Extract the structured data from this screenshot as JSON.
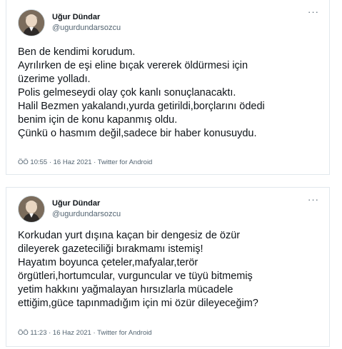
{
  "tweets": [
    {
      "author": {
        "display_name": "Uğur Dündar",
        "handle": "@ugurdundarsozcu",
        "avatar_icon": "profile-photo"
      },
      "more_icon": "···",
      "lines": [
        "Ben de kendimi korudum.",
        "Ayrılırken de eşi eline bıçak vererek öldürmesi için",
        "üzerime yolladı.",
        "Polis gelmeseydi olay çok kanlı sonuçlanacaktı.",
        "Halil Bezmen yakalandı,yurda getirildi,borçlarını ödedi",
        "benim için de konu kapanmış oldu.",
        "Çünkü o hasmım değil,sadece bir haber konusuydu."
      ],
      "meta": "ÖÖ 10:55 · 16 Haz 2021 · Twitter for Android"
    },
    {
      "author": {
        "display_name": "Uğur Dündar",
        "handle": "@ugurdundarsozcu",
        "avatar_icon": "profile-photo"
      },
      "more_icon": "···",
      "lines": [
        "Korkudan yurt dışına kaçan bir dengesiz de özür",
        "dileyerek gazeteciliği bırakmamı istemiş!",
        "Hayatım boyunca çeteler,mafyalar,terör",
        "örgütleri,hortumcular, vurguncular ve tüyü bitmemiş",
        "yetim hakkını yağmalayan hırsızlarla mücadele",
        "ettiğim,güce tapınmadığım için mi özür dileyeceğim?"
      ],
      "meta": "ÖÖ 11:23 · 16 Haz 2021 · Twitter for Android"
    }
  ],
  "colors": {
    "text": "#0f1419",
    "secondary": "#536471",
    "border": "#e1e8ed"
  }
}
